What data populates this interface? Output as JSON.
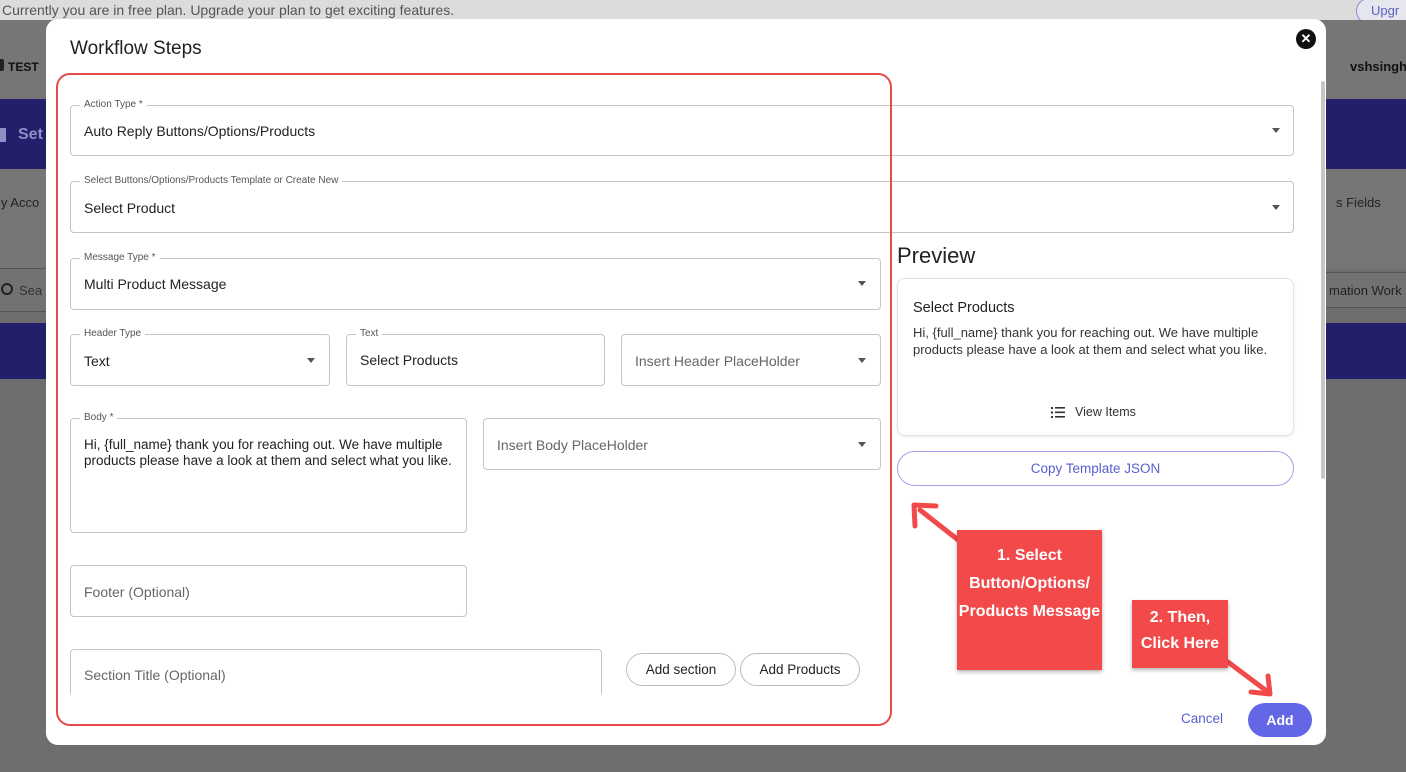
{
  "background": {
    "banner_text": "Currently you are in free plan. Upgrade your plan to get exciting features.",
    "upgrade_label": "Upgr",
    "workspace_label": "TEST",
    "user_label": "vshsingh",
    "settings_label": "Set",
    "accounts_label": "ly Acco",
    "fields_label": "s Fields",
    "search_placeholder": "Sea",
    "automation_label": "mation Work"
  },
  "modal": {
    "title": "Workflow Steps",
    "action_type": {
      "label": "Action Type *",
      "value": "Auto Reply Buttons/Options/Products"
    },
    "template_select": {
      "label": "Select Buttons/Options/Products Template or Create New",
      "value": "Select Product"
    },
    "message_type": {
      "label": "Message Type *",
      "value": "Multi Product Message"
    },
    "header_type": {
      "label": "Header Type",
      "value": "Text"
    },
    "header_text": {
      "label": "Text",
      "value": "Select Products"
    },
    "header_placeholder": {
      "placeholder": "Insert Header PlaceHolder"
    },
    "body": {
      "label": "Body *",
      "value": "Hi, {full_name} thank you for reaching out. We have multiple products please have a look at them and select what you like."
    },
    "body_placeholder": {
      "placeholder": "Insert Body PlaceHolder"
    },
    "footer": {
      "placeholder": "Footer (Optional)"
    },
    "section_title": {
      "placeholder": "Section Title (Optional)"
    },
    "add_section_label": "Add section",
    "add_products_label": "Add Products",
    "preview": {
      "heading": "Preview",
      "title": "Select Products",
      "body": "Hi, {full_name} thank you for reaching out. We have multiple products please have a look at them and select what you like.",
      "view_items_label": "View Items"
    },
    "copy_json_label": "Copy Template JSON",
    "cancel_label": "Cancel",
    "add_label": "Add"
  },
  "annotations": {
    "step1": "1. Select Button/Options/ Products Message",
    "step2": "2. Then, Click Here"
  },
  "colors": {
    "accent": "#6367e6",
    "annotation_red": "#f24a4a",
    "highlight_border": "#e64b4b",
    "nav_dark": "#22206a"
  },
  "icons": [
    "close-icon",
    "dropdown-arrow-icon",
    "list-icon",
    "search-icon"
  ]
}
